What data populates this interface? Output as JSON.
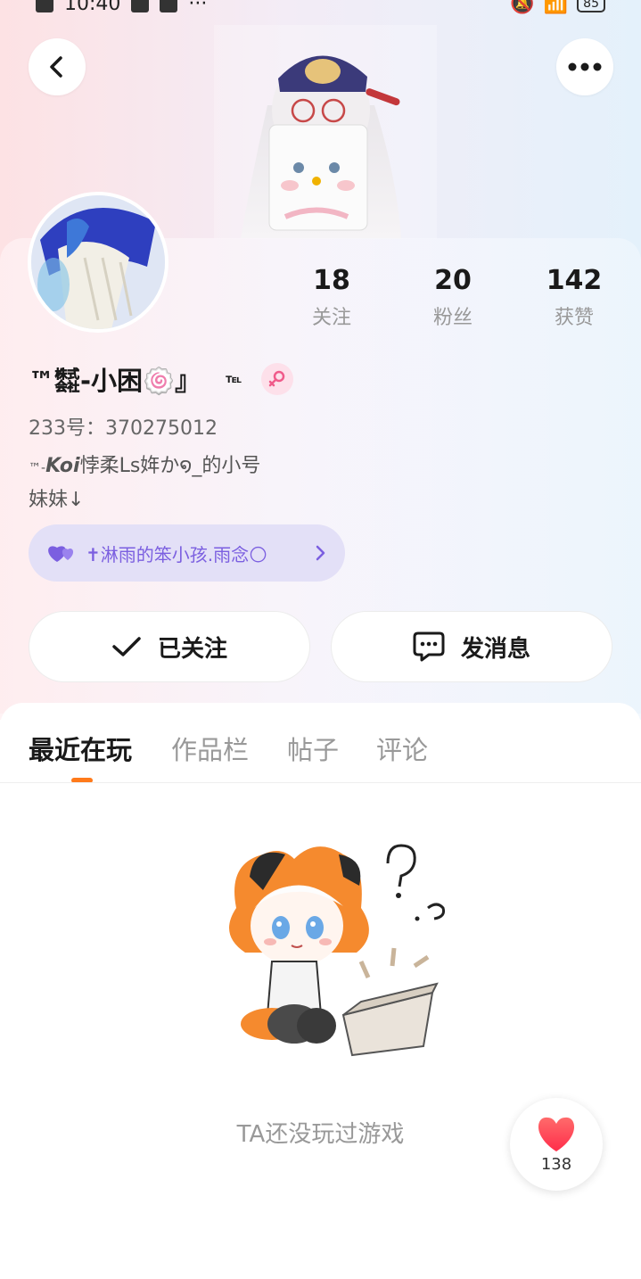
{
  "status_bar": {
    "time": "10:40",
    "dots": "···",
    "battery": "85"
  },
  "header": {
    "back_icon": "chevron-left-icon",
    "more_icon": "ellipsis-icon"
  },
  "profile": {
    "name": "™㍿-小困🍥』",
    "name_suffix": "℡",
    "gender_icon": "female-icon",
    "user_id": "233号：370275012",
    "bio_line1_prefix": "™-",
    "bio_line1_bold": "Koi",
    "bio_line1_rest": "悖柔Ls姩か໑_的小号",
    "bio_line2": "妹妹↓",
    "companion": {
      "icon": "double-heart-icon",
      "name": "✝淋雨的笨小孩.雨念🌕",
      "arrow_icon": "chevron-right-icon"
    }
  },
  "stats": [
    {
      "value": "18",
      "label": "关注"
    },
    {
      "value": "20",
      "label": "粉丝"
    },
    {
      "value": "142",
      "label": "获赞"
    }
  ],
  "actions": {
    "follow_label": "已关注",
    "message_label": "发消息"
  },
  "tabs": [
    {
      "label": "最近在玩",
      "active": true
    },
    {
      "label": "作品栏",
      "active": false
    },
    {
      "label": "帖子",
      "active": false
    },
    {
      "label": "评论",
      "active": false
    }
  ],
  "empty_state": {
    "text": "TA还没玩过游戏"
  },
  "like": {
    "count": "138"
  },
  "colors": {
    "accent": "#ff7a1a",
    "companion_text": "#7b5fe0",
    "heart": "#ff3b4e"
  }
}
